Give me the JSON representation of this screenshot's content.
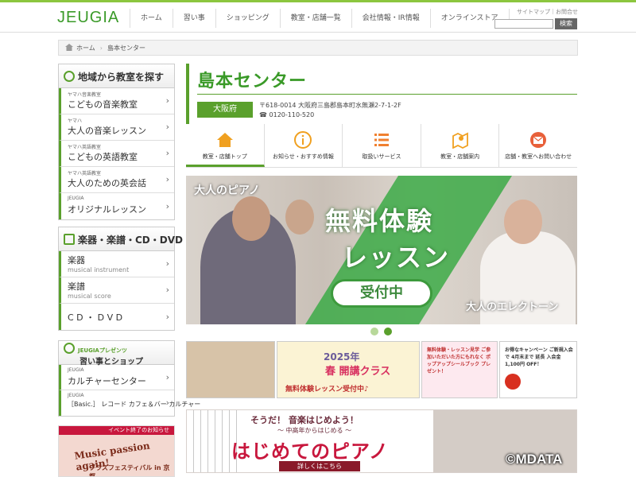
{
  "header": {
    "logo": "JEUGIA",
    "nav": [
      "ホーム",
      "習い事",
      "ショッピング",
      "教室・店舗一覧",
      "会社情報・IR情報",
      "オンラインストア"
    ],
    "util_links": "サイトマップ｜お問合せ",
    "search_button": "検索"
  },
  "breadcrumb": {
    "home": "ホーム",
    "current": "島本センター"
  },
  "sidebar_region": {
    "title": "地域から教室を探す",
    "items": [
      {
        "small": "ヤマハ音楽教室",
        "big": "こどもの音楽教室"
      },
      {
        "small": "ヤマハ",
        "big": "大人の音楽レッスン"
      },
      {
        "small": "ヤマハ英語教室",
        "big": "こどもの英語教室"
      },
      {
        "small": "ヤマハ英語教室",
        "big": "大人のための英会話"
      },
      {
        "small": "JEUGIA",
        "big": "オリジナルレッスン"
      }
    ]
  },
  "sidebar_products": {
    "title": "楽器・楽譜・CD・DVD",
    "items": [
      {
        "big": "楽器",
        "sub": "musical instrument"
      },
      {
        "big": "楽譜",
        "sub": "musical score"
      },
      {
        "big": "C D ・ D V D",
        "sub": ""
      }
    ]
  },
  "sidebar_presents": {
    "title_small": "JEUGIAプレゼンツ",
    "title": "習い事とショップ",
    "items": [
      {
        "small": "JEUGIA",
        "big": "カルチャーセンター"
      },
      {
        "small": "JEUGIA",
        "big": "［Basic.］ レコード カフェ＆バー カルチャー"
      }
    ]
  },
  "promo": {
    "bar": "イベント終了のお知らせ",
    "line1": "Music passion again!",
    "line2": "ブラスフェスティバル in 京都"
  },
  "center": {
    "name": "島本センター",
    "prefecture": "大阪府",
    "address": "〒618-0014 大阪府三島郡島本町水無瀬2-7-1-2F",
    "tel": "0120-110-520"
  },
  "tabs": [
    {
      "label": "教室・店舗トップ",
      "icon": "home-icon",
      "active": true
    },
    {
      "label": "お知らせ・おすすめ情報",
      "icon": "info-icon",
      "active": false
    },
    {
      "label": "取扱いサービス",
      "icon": "list-icon",
      "active": false
    },
    {
      "label": "教室・店舗案内",
      "icon": "map-icon",
      "active": false
    },
    {
      "label": "店舗・教室へお問い合わせ",
      "icon": "mail-icon",
      "active": false
    }
  ],
  "hero": {
    "top_left": "大人のピアノ",
    "line1": "無料体験",
    "line2": "レッスン",
    "button": "受付中",
    "bottom_right": "大人のエレクトーン"
  },
  "slider": {
    "count": 2,
    "active_index": 1
  },
  "banners": {
    "spring_year": "2025年",
    "spring_title": "春 開講クラス",
    "spring_sub": "無料体験レッスン受付中♪",
    "campaign_a": "無料体験・レッスン見学 ご参加いただいた方にもれなく ポップアップシールブック プレゼント！",
    "campaign_b": "お得なキャンペーン ご新規入会で 4月末まで 延長 入会金 1,100円 OFF！"
  },
  "piano_banner": {
    "question": "そうだ！ 音楽はじめよう！",
    "sub": "〜 中高年からはじめる 〜",
    "headline": "はじめてのピアノ",
    "detail": "詳しくはこちら"
  },
  "watermark": "©MDATA",
  "colors": {
    "accent": "#5aa02c",
    "brand": "#3a9a28",
    "promo": "#c8173d"
  }
}
